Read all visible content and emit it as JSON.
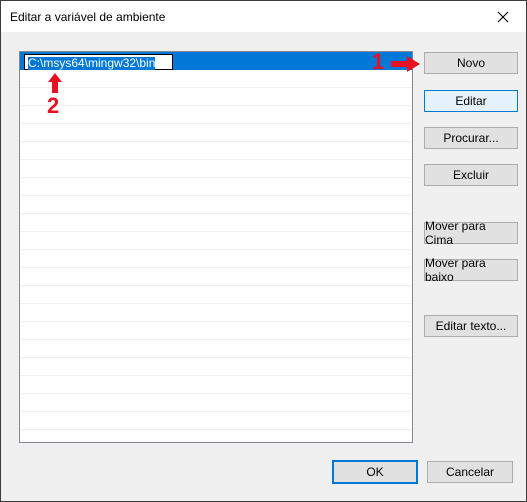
{
  "window": {
    "title": "Editar a variável de ambiente",
    "close_icon": "close-icon"
  },
  "list": {
    "editing_value": "C:\\msys64\\mingw32\\bin",
    "row_count": 21
  },
  "buttons": {
    "new": "Novo",
    "edit": "Editar",
    "browse": "Procurar...",
    "delete": "Excluir",
    "move_up": "Mover para Cima",
    "move_down": "Mover para baixo",
    "edit_text": "Editar texto...",
    "ok": "OK",
    "cancel": "Cancelar"
  },
  "annotations": {
    "marker_1": "1",
    "marker_2": "2",
    "arrow_right_icon": "arrow-right-icon",
    "arrow_up_icon": "arrow-up-icon",
    "color": "#e81123"
  },
  "colors": {
    "selection": "#0078d7",
    "focus_border": "#0078d7"
  }
}
